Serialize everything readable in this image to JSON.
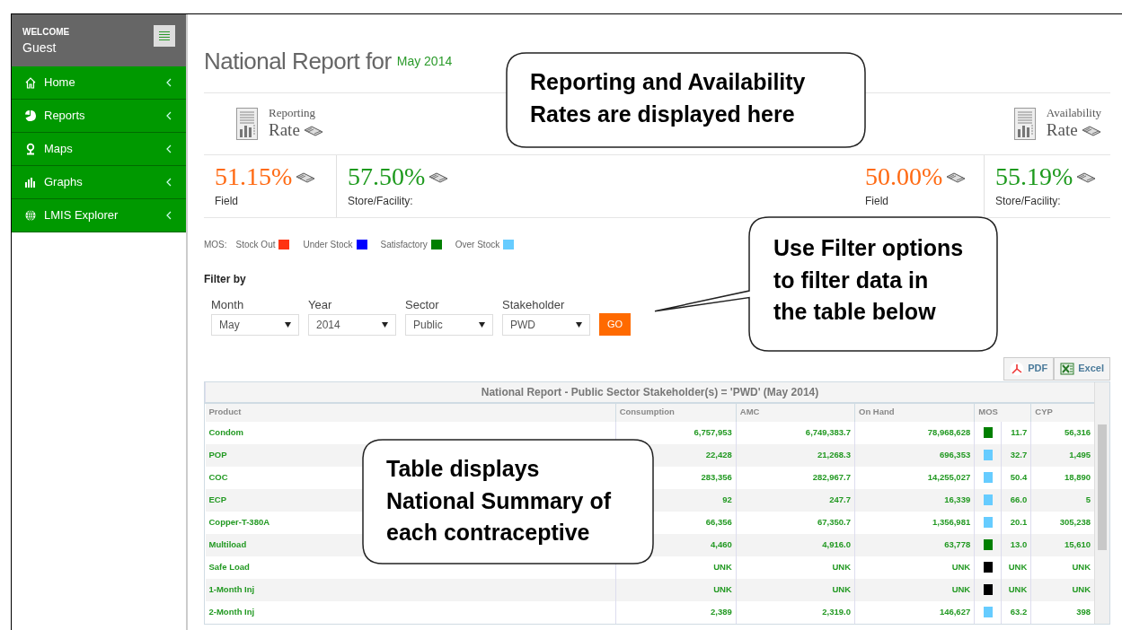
{
  "sidebar": {
    "welcome": "WELCOME",
    "user": "Guest",
    "items": [
      {
        "label": "Home",
        "kind": "home"
      },
      {
        "label": "Reports",
        "kind": "reports"
      },
      {
        "label": "Maps",
        "kind": "maps"
      },
      {
        "label": "Graphs",
        "kind": "graphs"
      },
      {
        "label": "LMIS Explorer",
        "kind": "explorer"
      }
    ]
  },
  "page_title": {
    "text": "National Report for",
    "period": "May 2014"
  },
  "rate_headers": [
    {
      "small": "Reporting",
      "big": "Rate"
    },
    {
      "small": "Availability",
      "big": "Rate"
    }
  ],
  "metrics": [
    {
      "value": "51.15%",
      "label": "Field",
      "color": "#ff6a13"
    },
    {
      "value": "57.50%",
      "label": "Store/Facility:",
      "color": "#1e9a1e"
    },
    {
      "value": "50.00%",
      "label": "Field",
      "color": "#ff6a13"
    },
    {
      "value": "55.19%",
      "label": "Store/Facility:",
      "color": "#1e9a1e"
    }
  ],
  "legend": {
    "label": "MOS:",
    "items": [
      {
        "label": "Stock Out",
        "color": "#ff3311"
      },
      {
        "label": "Under Stock",
        "color": "#0000ff"
      },
      {
        "label": "Satisfactory",
        "color": "#007f00"
      },
      {
        "label": "Over Stock",
        "color": "#66ccff"
      }
    ]
  },
  "filter": {
    "title": "Filter by",
    "fields": [
      {
        "label": "Month",
        "value": "May"
      },
      {
        "label": "Year",
        "value": "2014"
      },
      {
        "label": "Sector",
        "value": "Public"
      },
      {
        "label": "Stakeholder",
        "value": "PWD"
      }
    ],
    "button": "GO"
  },
  "exports": [
    {
      "label": "PDF",
      "kind": "pdf"
    },
    {
      "label": "Excel",
      "kind": "excel"
    }
  ],
  "table": {
    "title": "National Report - Public Sector Stakeholder(s) = 'PWD' (May 2014)",
    "columns": [
      "Product",
      "Consumption",
      "AMC",
      "On Hand",
      "MOS",
      "CYP"
    ],
    "rows": [
      {
        "product": "Condom",
        "consumption": "6,757,953",
        "amc": "6,749,383.7",
        "on_hand": "78,968,628",
        "color": "#007f00",
        "mos": "11.7",
        "cyp": "56,316"
      },
      {
        "product": "POP",
        "consumption": "22,428",
        "amc": "21,268.3",
        "on_hand": "696,353",
        "color": "#66ccff",
        "mos": "32.7",
        "cyp": "1,495"
      },
      {
        "product": "COC",
        "consumption": "283,356",
        "amc": "282,967.7",
        "on_hand": "14,255,027",
        "color": "#66ccff",
        "mos": "50.4",
        "cyp": "18,890"
      },
      {
        "product": "ECP",
        "consumption": "92",
        "amc": "247.7",
        "on_hand": "16,339",
        "color": "#66ccff",
        "mos": "66.0",
        "cyp": "5"
      },
      {
        "product": "Copper-T-380A",
        "consumption": "66,356",
        "amc": "67,350.7",
        "on_hand": "1,356,981",
        "color": "#66ccff",
        "mos": "20.1",
        "cyp": "305,238"
      },
      {
        "product": "Multiload",
        "consumption": "4,460",
        "amc": "4,916.0",
        "on_hand": "63,778",
        "color": "#007f00",
        "mos": "13.0",
        "cyp": "15,610"
      },
      {
        "product": "Safe Load",
        "consumption": "UNK",
        "amc": "UNK",
        "on_hand": "UNK",
        "color": "#000000",
        "mos": "UNK",
        "cyp": "UNK"
      },
      {
        "product": "1-Month Inj",
        "consumption": "UNK",
        "amc": "UNK",
        "on_hand": "UNK",
        "color": "#000000",
        "mos": "UNK",
        "cyp": "UNK"
      },
      {
        "product": "2-Month Inj",
        "consumption": "2,389",
        "amc": "2,319.0",
        "on_hand": "146,627",
        "color": "#66ccff",
        "mos": "63.2",
        "cyp": "398"
      }
    ]
  },
  "callouts": [
    {
      "text": "Reporting and Availability Rates are displayed here",
      "pointer": false
    },
    {
      "text": "Use Filter options to filter data in the table below",
      "pointer": true
    },
    {
      "text": "Table displays National Summary of each contraceptive",
      "pointer": false
    }
  ]
}
